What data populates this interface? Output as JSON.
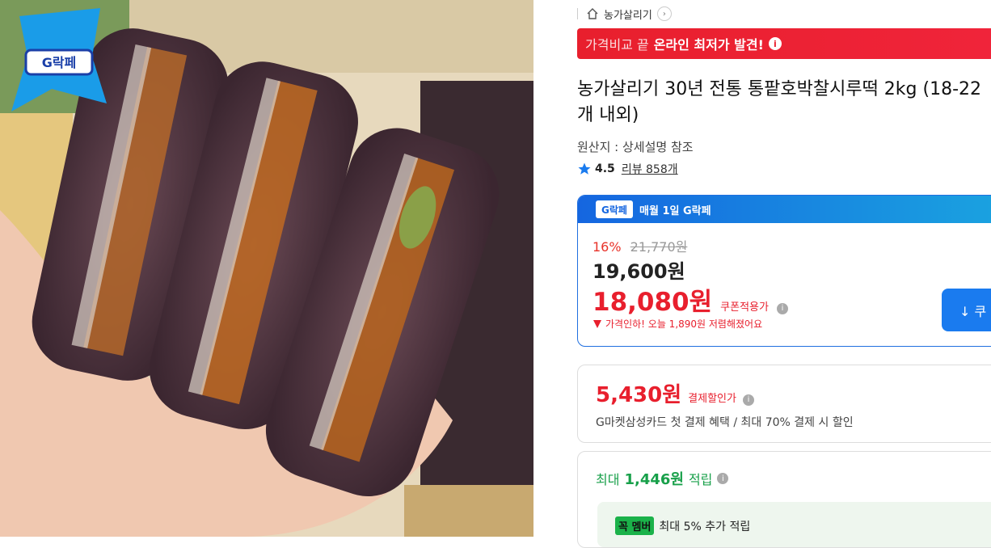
{
  "product_image": {
    "badge_text": "G락페"
  },
  "store": {
    "name": "농가살리기",
    "chevron": "›"
  },
  "promo_banner": {
    "light_text": "가격비교 끝",
    "bold_text": "온라인 최저가 발견!",
    "info": "i"
  },
  "product": {
    "title": "농가살리기 30년 전통 통팥호박찰시루떡 2kg (18-22개 내외)",
    "origin": "원산지 : 상세설명 참조",
    "rating": "4.5",
    "reviews": "리뷰 858개"
  },
  "deal": {
    "badge": "G락페",
    "header": "매월 1일 G락페",
    "discount_pct": "16%",
    "original_price": "21,770원",
    "sale_price": "19,600원",
    "coupon_price": "18,080원",
    "coupon_label": "쿠폰적용가",
    "price_drop": "가격인하! 오늘 1,890원 저렴해졌어요",
    "coupon_button": "↓ 쿠"
  },
  "payment": {
    "price": "5,430원",
    "label": "결제할인가",
    "description": "G마켓삼성카드 첫 결제 혜택 / 최대 70% 결제 시 할인"
  },
  "points": {
    "prefix": "최대",
    "amount": "1,446원",
    "suffix": "적립",
    "member_logo": "꼭 멤버",
    "member_text": "최대 5% 추가 적립"
  },
  "colors": {
    "accent_red": "#e81f2d",
    "brand_blue": "#1a7bef",
    "point_green": "#18a04a"
  }
}
